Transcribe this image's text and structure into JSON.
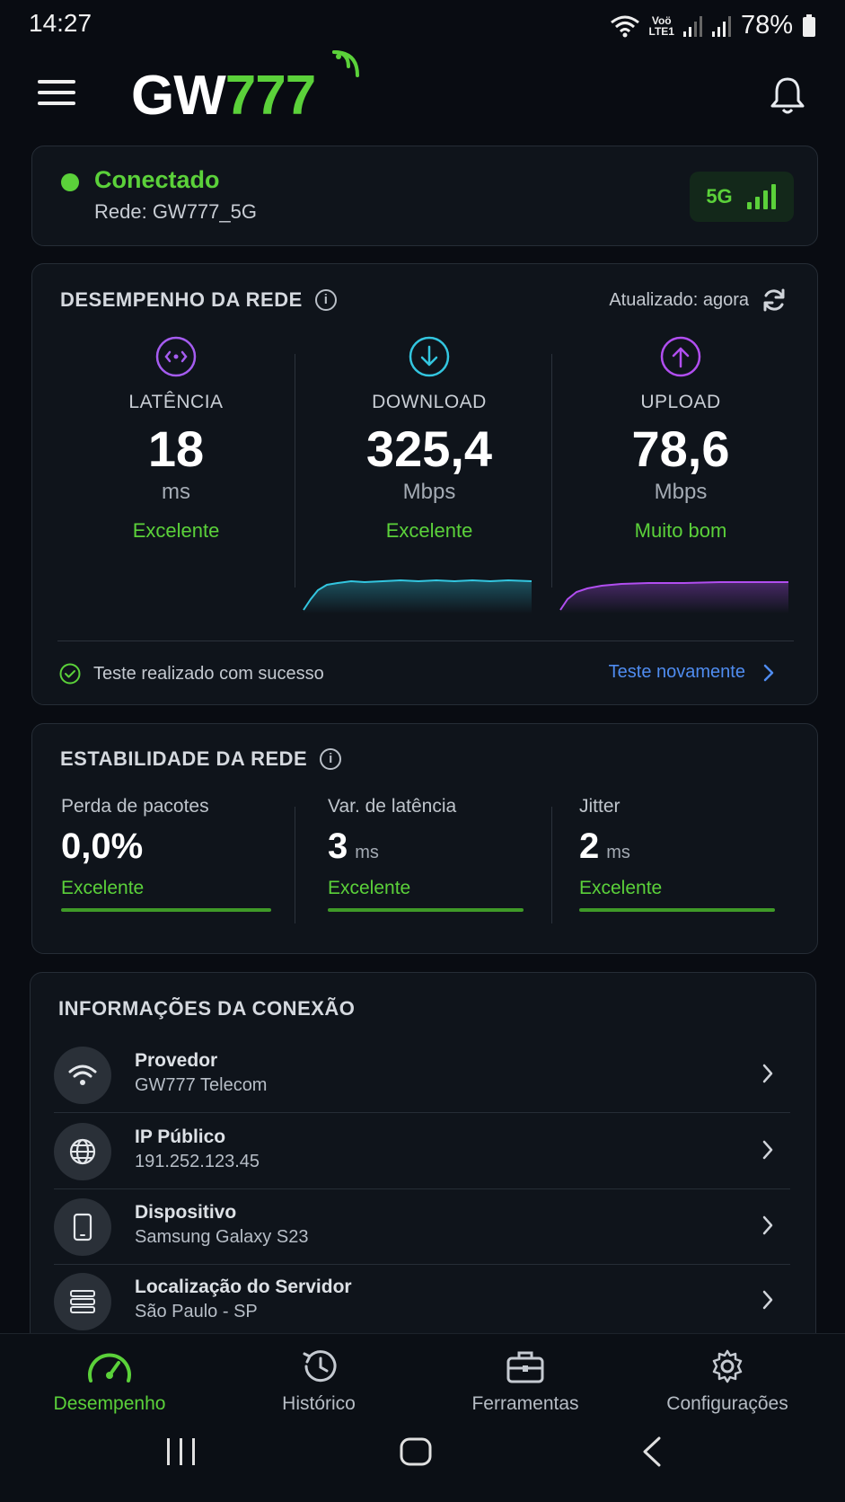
{
  "status_bar": {
    "time": "14:27",
    "lte_top": "Voö",
    "lte_bottom": "LTE1",
    "battery": "78%"
  },
  "header": {
    "logo_white": "GW",
    "logo_green": "777",
    "accent": "#5bd13a"
  },
  "connection": {
    "status": "Conectado",
    "network": "Rede: GW777_5G",
    "badge": "5G"
  },
  "performance": {
    "title": "DESEMPENHO DA REDE",
    "updated": "Atualizado: agora",
    "metrics": [
      {
        "label": "LATÊNCIA",
        "value": "18",
        "unit": "ms",
        "status": "Excelente",
        "icon": "latency-icon",
        "color": "#a55cf0"
      },
      {
        "label": "DOWNLOAD",
        "value": "325,4",
        "unit": "Mbps",
        "status": "Excelente",
        "icon": "download-icon",
        "color": "#33c6e0"
      },
      {
        "label": "UPLOAD",
        "value": "78,6",
        "unit": "Mbps",
        "status": "Muito bom",
        "icon": "upload-icon",
        "color": "#b14ef0"
      }
    ],
    "result": "Teste realizado com sucesso",
    "retest": "Teste novamente"
  },
  "stability": {
    "title": "ESTABILIDADE DA REDE",
    "items": [
      {
        "label": "Perda de pacotes",
        "value": "0,0%",
        "unit": "",
        "status": "Excelente"
      },
      {
        "label": "Var. de latência",
        "value": "3",
        "unit": "ms",
        "status": "Excelente"
      },
      {
        "label": "Jitter",
        "value": "2",
        "unit": "ms",
        "status": "Excelente"
      }
    ]
  },
  "info": {
    "title": "INFORMAÇÕES DA CONEXÃO",
    "rows": [
      {
        "title": "Provedor",
        "value": "GW777 Telecom",
        "icon": "wifi-icon"
      },
      {
        "title": "IP Público",
        "value": "191.252.123.45",
        "icon": "globe-icon"
      },
      {
        "title": "Dispositivo",
        "value": "Samsung Galaxy S23",
        "icon": "phone-icon"
      },
      {
        "title": "Localização do Servidor",
        "value": "São Paulo - SP",
        "icon": "server-icon"
      }
    ]
  },
  "nav": {
    "items": [
      {
        "label": "Desempenho",
        "icon": "speedometer-icon",
        "active": true
      },
      {
        "label": "Histórico",
        "icon": "history-icon",
        "active": false
      },
      {
        "label": "Ferramentas",
        "icon": "toolbox-icon",
        "active": false
      },
      {
        "label": "Configurações",
        "icon": "gear-icon",
        "active": false
      }
    ]
  }
}
